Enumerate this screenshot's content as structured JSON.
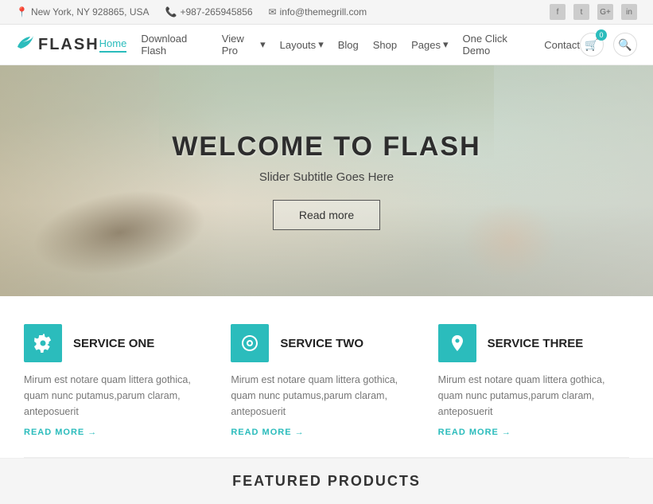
{
  "topbar": {
    "address": "New York, NY 928865, USA",
    "phone": "+987-265945856",
    "email": "info@themegrill.com",
    "address_icon": "📍",
    "phone_icon": "📞",
    "email_icon": "✉",
    "socials": [
      "f",
      "t",
      "G+",
      "in"
    ]
  },
  "header": {
    "logo_text": "FLASH",
    "logo_icon": "🐦",
    "cart_count": "0",
    "nav": [
      {
        "label": "Home",
        "active": true,
        "has_dropdown": false
      },
      {
        "label": "Download Flash",
        "active": false,
        "has_dropdown": false
      },
      {
        "label": "View Pro",
        "active": false,
        "has_dropdown": true
      },
      {
        "label": "Layouts",
        "active": false,
        "has_dropdown": true
      },
      {
        "label": "Blog",
        "active": false,
        "has_dropdown": false
      },
      {
        "label": "Shop",
        "active": false,
        "has_dropdown": false
      },
      {
        "label": "Pages",
        "active": false,
        "has_dropdown": true
      },
      {
        "label": "One Click Demo",
        "active": false,
        "has_dropdown": false
      },
      {
        "label": "Contact",
        "active": false,
        "has_dropdown": false
      }
    ]
  },
  "hero": {
    "title": "WELCOME TO FLASH",
    "subtitle": "Slider Subtitle Goes Here",
    "button_label": "Read more"
  },
  "services": [
    {
      "icon": "gear",
      "title": "SERVICE ONE",
      "description": "Mirum est notare quam littera gothica, quam nunc putamus,parum claram, anteposuerit",
      "link_label": "READ MORE",
      "link_arrow": "→"
    },
    {
      "icon": "target",
      "title": "SERVICE TWO",
      "description": "Mirum est notare quam littera gothica, quam nunc putamus,parum claram, anteposuerit",
      "link_label": "READ MORE",
      "link_arrow": "→"
    },
    {
      "icon": "location",
      "title": "SERVICE THREE",
      "description": "Mirum est notare quam littera gothica, quam nunc putamus,parum claram, anteposuerit",
      "link_label": "READ MORE",
      "link_arrow": "→"
    }
  ],
  "bottom_teaser": {
    "title": "FEATURED PRODUCTS"
  }
}
